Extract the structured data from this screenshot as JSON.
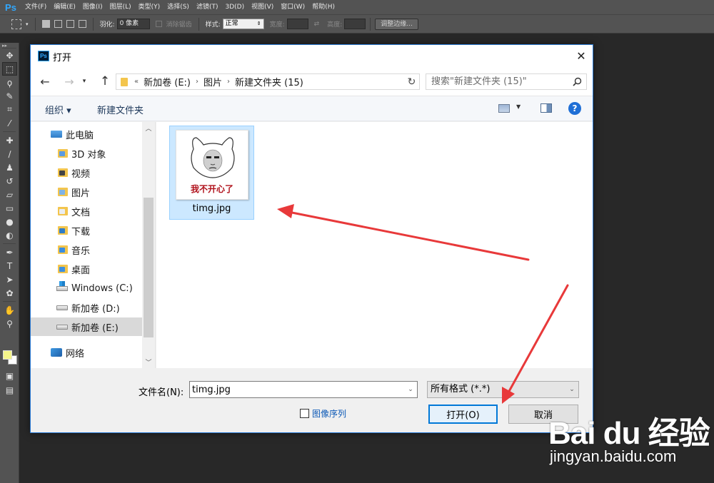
{
  "ps": {
    "logo": "Ps",
    "menu": [
      "文件(F)",
      "编辑(E)",
      "图像(I)",
      "图层(L)",
      "类型(Y)",
      "选择(S)",
      "滤镜(T)",
      "3D(D)",
      "视图(V)",
      "窗口(W)",
      "帮助(H)"
    ],
    "options": {
      "feather_label": "羽化:",
      "feather_value": "0 像素",
      "antialias_label": "消除锯齿",
      "style_label": "样式:",
      "style_value": "正常",
      "width_label": "宽度:",
      "height_label": "高度:",
      "refine_edge_label": "调整边缘..."
    },
    "colors": {
      "foreground": "#f4f48a",
      "background": "#ffffff",
      "accent": "#31a8ff"
    }
  },
  "dialog": {
    "icon": "Ps",
    "title": "打开",
    "nav": {
      "overflow": "«",
      "breadcrumbs": [
        "新加卷 (E:)",
        "图片",
        "新建文件夹 (15)"
      ],
      "search_placeholder": "搜索\"新建文件夹 (15)\""
    },
    "toolbar": {
      "organize": "组织 ▾",
      "new_folder": "新建文件夹",
      "help": "?"
    },
    "sidebar": [
      {
        "label": "此电脑",
        "icon": "computer-icon",
        "selected": false
      },
      {
        "label": "3D 对象",
        "icon": "3d-objects-folder-icon",
        "selected": false
      },
      {
        "label": "视频",
        "icon": "videos-folder-icon",
        "selected": false
      },
      {
        "label": "图片",
        "icon": "pictures-folder-icon",
        "selected": false
      },
      {
        "label": "文档",
        "icon": "documents-folder-icon",
        "selected": false
      },
      {
        "label": "下载",
        "icon": "downloads-folder-icon",
        "selected": false
      },
      {
        "label": "音乐",
        "icon": "music-folder-icon",
        "selected": false
      },
      {
        "label": "桌面",
        "icon": "desktop-folder-icon",
        "selected": false
      },
      {
        "label": "Windows (C:)",
        "icon": "windows-drive-icon",
        "selected": false
      },
      {
        "label": "新加卷 (D:)",
        "icon": "drive-icon",
        "selected": false
      },
      {
        "label": "新加卷 (E:)",
        "icon": "drive-icon",
        "selected": true
      },
      {
        "label": "网络",
        "icon": "network-icon",
        "selected": false
      }
    ],
    "files": [
      {
        "name": "timg.jpg",
        "thumb_caption": "我不开心了",
        "selected": true
      }
    ],
    "bottom": {
      "filename_label": "文件名(N):",
      "filename_value": "timg.jpg",
      "filetype_value": "所有格式 (*.*)",
      "sequence_label": "图像序列",
      "open_button": "打开(O)",
      "cancel_button": "取消"
    }
  },
  "watermark": {
    "logo": "Bai du 经验",
    "url": "jingyan.baidu.com"
  },
  "annotation_color": "#e8393a"
}
